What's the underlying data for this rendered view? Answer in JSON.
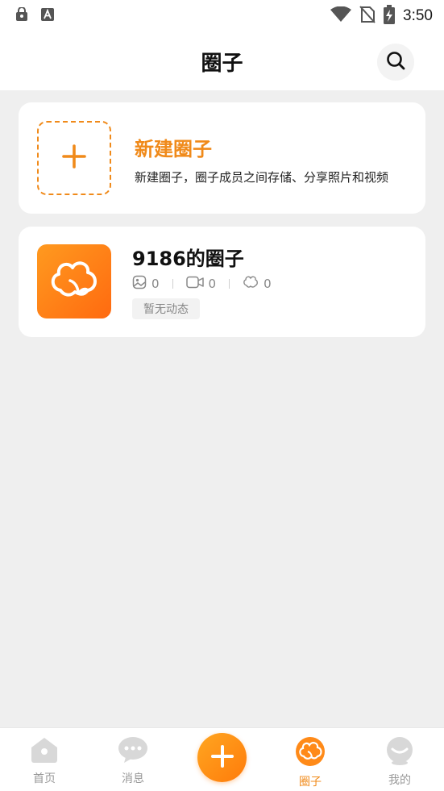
{
  "status_bar": {
    "time": "3:50",
    "left_icons": [
      "security-lock-icon",
      "font-a-icon"
    ],
    "right_icons": [
      "wifi-icon",
      "no-sim-icon",
      "battery-charging-icon"
    ]
  },
  "header": {
    "title": "圈子",
    "search_icon": "search-icon"
  },
  "new_circle_card": {
    "title": "新建圈子",
    "description": "新建圈子，圈子成员之间存储、分享照片和视频",
    "icon": "plus-icon"
  },
  "circles": [
    {
      "name": "9186的圈子",
      "avatar_icon": "cotton-flower-icon",
      "stats": {
        "photos": "0",
        "videos": "0",
        "members": "0"
      },
      "badge": "暂无动态"
    }
  ],
  "bottom_nav": {
    "items": [
      {
        "label": "首页",
        "icon": "home-icon",
        "active": false
      },
      {
        "label": "消息",
        "icon": "chat-icon",
        "active": false
      },
      {
        "label": "",
        "icon": "plus-icon",
        "active": false
      },
      {
        "label": "圈子",
        "icon": "cotton-flower-icon",
        "active": true
      },
      {
        "label": "我的",
        "icon": "profile-icon",
        "active": false
      }
    ]
  },
  "colors": {
    "accent": "#f08a1a",
    "background": "#efefef",
    "card": "#ffffff",
    "muted_text": "#888888"
  }
}
